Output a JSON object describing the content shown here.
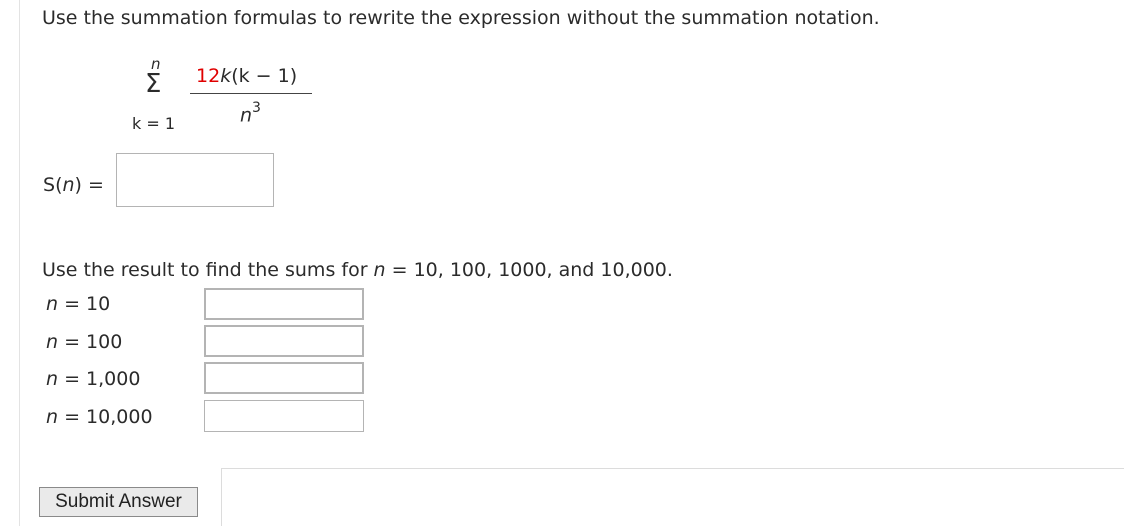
{
  "question": {
    "instruction": "Use the summation formulas to rewrite the expression without the summation notation.",
    "summation": {
      "upper_limit": "n",
      "sigma_symbol": "Σ",
      "lower_limit": "k = 1",
      "numerator_coefficient": "12",
      "numerator_var": "k",
      "numerator_rest": "(k − 1)",
      "denominator_base": "n",
      "denominator_exponent": "3"
    },
    "sn_label_func": "S",
    "sn_label_arg": "n",
    "sn_label_eq": "=",
    "sn_input_value": ""
  },
  "part_two": {
    "text_prefix": "Use the result to find the sums for ",
    "text_var": "n",
    "text_suffix": " = 10, 100, 1000, and 10,000.",
    "rows": [
      {
        "var": "n",
        "label": " = 10",
        "value": ""
      },
      {
        "var": "n",
        "label": " = 100",
        "value": ""
      },
      {
        "var": "n",
        "label": " = 1,000",
        "value": ""
      },
      {
        "var": "n",
        "label": " = 10,000",
        "value": ""
      }
    ]
  },
  "actions": {
    "submit_label": "Submit Answer"
  },
  "colors": {
    "coefficient_highlight": "#e00000",
    "input_border": "#b4b4b4",
    "button_background": "#eaeaea"
  }
}
